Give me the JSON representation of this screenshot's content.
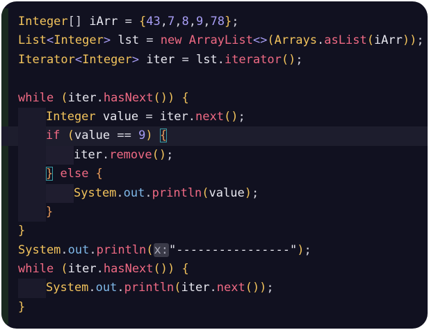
{
  "editor": {
    "lines": [
      {
        "tokens": [
          [
            "t-type",
            "Integer"
          ],
          [
            "t-punc",
            "[] "
          ],
          [
            "t-id",
            "iArr"
          ],
          [
            "t-punc",
            " = "
          ],
          [
            "t-paren",
            "{"
          ],
          [
            "t-num",
            "43"
          ],
          [
            "t-punc",
            ","
          ],
          [
            "t-num",
            "7"
          ],
          [
            "t-punc",
            ","
          ],
          [
            "t-num",
            "8"
          ],
          [
            "t-punc",
            ","
          ],
          [
            "t-num",
            "9"
          ],
          [
            "t-punc",
            ","
          ],
          [
            "t-num",
            "78"
          ],
          [
            "t-paren",
            "}"
          ],
          [
            "t-punc",
            ";"
          ]
        ]
      },
      {
        "tokens": [
          [
            "t-type",
            "List"
          ],
          [
            "t-gen",
            "<"
          ],
          [
            "t-type",
            "Integer"
          ],
          [
            "t-gen",
            ">"
          ],
          [
            "t-id",
            " lst"
          ],
          [
            "t-punc",
            " = "
          ],
          [
            "t-kw",
            "new "
          ],
          [
            "t-fn",
            "ArrayList"
          ],
          [
            "t-gen",
            "<>"
          ],
          [
            "t-paren",
            "("
          ],
          [
            "t-type",
            "Arrays"
          ],
          [
            "t-punc",
            "."
          ],
          [
            "t-fn",
            "asList"
          ],
          [
            "t-paren",
            "("
          ],
          [
            "t-id",
            "iArr"
          ],
          [
            "t-paren",
            "))"
          ],
          [
            "t-punc",
            ";"
          ]
        ]
      },
      {
        "tokens": [
          [
            "t-type",
            "Iterator"
          ],
          [
            "t-gen",
            "<"
          ],
          [
            "t-type",
            "Integer"
          ],
          [
            "t-gen",
            ">"
          ],
          [
            "t-id",
            " iter"
          ],
          [
            "t-punc",
            " = "
          ],
          [
            "t-id",
            "lst"
          ],
          [
            "t-punc",
            "."
          ],
          [
            "t-fn",
            "iterator"
          ],
          [
            "t-paren",
            "()"
          ],
          [
            "t-punc",
            ";"
          ]
        ]
      },
      {
        "tokens": []
      },
      {
        "tokens": [
          [
            "t-kw",
            "while "
          ],
          [
            "t-paren",
            "("
          ],
          [
            "t-id",
            "iter"
          ],
          [
            "t-punc",
            "."
          ],
          [
            "t-fn",
            "hasNext"
          ],
          [
            "t-paren",
            "()) "
          ],
          [
            "t-brace",
            "{"
          ]
        ]
      },
      {
        "indent": 1,
        "tokens": [
          [
            "t-type",
            "Integer"
          ],
          [
            "t-id",
            " value"
          ],
          [
            "t-punc",
            " = "
          ],
          [
            "t-id",
            "iter"
          ],
          [
            "t-punc",
            "."
          ],
          [
            "t-fn",
            "next"
          ],
          [
            "t-paren",
            "()"
          ],
          [
            "t-punc",
            ";"
          ]
        ]
      },
      {
        "indent": 1,
        "hl": true,
        "tokens": [
          [
            "t-kw",
            "if "
          ],
          [
            "t-paren",
            "("
          ],
          [
            "t-id",
            "value"
          ],
          [
            "t-punc",
            " == "
          ],
          [
            "t-num",
            "9"
          ],
          [
            "t-paren",
            ") "
          ],
          [
            "t-brace-m match",
            "{"
          ]
        ]
      },
      {
        "indent": 2,
        "tokens": [
          [
            "t-id",
            "iter"
          ],
          [
            "t-punc",
            "."
          ],
          [
            "t-fn",
            "remove"
          ],
          [
            "t-paren",
            "()"
          ],
          [
            "t-punc",
            ";"
          ]
        ]
      },
      {
        "indent": 1,
        "tokens": [
          [
            "t-brace-m match",
            "}"
          ],
          [
            "t-kw",
            " else "
          ],
          [
            "t-brace-m",
            "{"
          ]
        ]
      },
      {
        "indent": 2,
        "tokens": [
          [
            "t-type",
            "System"
          ],
          [
            "t-punc",
            "."
          ],
          [
            "t-field",
            "out"
          ],
          [
            "t-punc",
            "."
          ],
          [
            "t-fn",
            "println"
          ],
          [
            "t-paren",
            "("
          ],
          [
            "t-id",
            "value"
          ],
          [
            "t-paren",
            ")"
          ],
          [
            "t-punc",
            ";"
          ]
        ]
      },
      {
        "indent": 1,
        "tokens": [
          [
            "t-brace-m",
            "}"
          ]
        ]
      },
      {
        "tokens": [
          [
            "t-brace",
            "}"
          ]
        ]
      },
      {
        "tokens": [
          [
            "t-type",
            "System"
          ],
          [
            "t-punc",
            "."
          ],
          [
            "t-field",
            "out"
          ],
          [
            "t-punc",
            "."
          ],
          [
            "t-fn",
            "println"
          ],
          [
            "t-paren",
            "("
          ],
          [
            "hint",
            "x:"
          ],
          [
            "t-str",
            "\"----------------\""
          ],
          [
            "t-paren",
            ")"
          ],
          [
            "t-punc",
            ";"
          ]
        ]
      },
      {
        "tokens": [
          [
            "t-kw",
            "while "
          ],
          [
            "t-paren",
            "("
          ],
          [
            "t-id",
            "iter"
          ],
          [
            "t-punc",
            "."
          ],
          [
            "t-fn",
            "hasNext"
          ],
          [
            "t-paren",
            "()) "
          ],
          [
            "t-brace",
            "{"
          ]
        ]
      },
      {
        "indent": 1,
        "tokens": [
          [
            "t-type",
            "System"
          ],
          [
            "t-punc",
            "."
          ],
          [
            "t-field",
            "out"
          ],
          [
            "t-punc",
            "."
          ],
          [
            "t-fn",
            "println"
          ],
          [
            "t-paren",
            "("
          ],
          [
            "t-id",
            "iter"
          ],
          [
            "t-punc",
            "."
          ],
          [
            "t-fn",
            "next"
          ],
          [
            "t-paren",
            "())"
          ],
          [
            "t-punc",
            ";"
          ]
        ]
      },
      {
        "tokens": [
          [
            "t-brace",
            "}"
          ]
        ]
      }
    ]
  }
}
